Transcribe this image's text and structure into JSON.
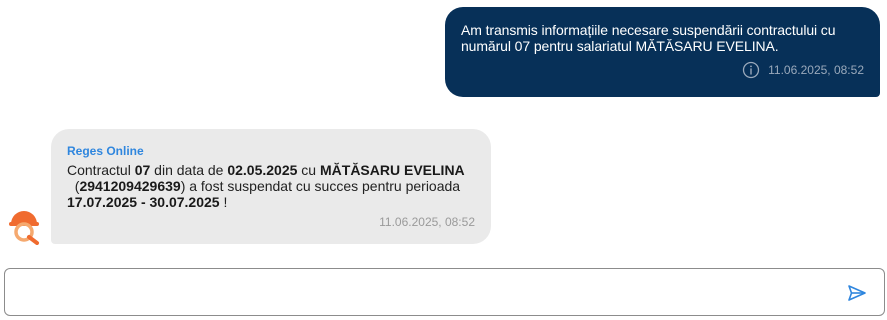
{
  "messages": {
    "outgoing": {
      "text": "Am transmis informațiile necesare suspendării contractului cu numărul 07 pentru salariatul MĂTĂSARU  EVELINA.",
      "timestamp": "11.06.2025, 08:52",
      "info_icon": "info-circle-icon"
    },
    "incoming": {
      "sender": "Reges Online",
      "parts": {
        "p1": "Contractul ",
        "contract_no": "07",
        "p2": " din data de ",
        "date": "02.05.2025",
        "p3": " cu ",
        "name": "MĂTĂSARU EVELINA",
        "p4": "  (",
        "cnp": "2941209429639",
        "p5": ") a fost suspendat cu succes pentru perioada ",
        "period": "17.07.2025 - 30.07.2025",
        "p6": " !"
      },
      "timestamp": "11.06.2025, 08:52",
      "avatar_icon": "reges-logo-icon"
    }
  },
  "composer": {
    "placeholder": "",
    "value": "",
    "send_icon": "send-icon"
  },
  "colors": {
    "outgoing_bg": "#073058",
    "incoming_bg": "#eaeaea",
    "sender": "#2f86de",
    "send_icon": "#2f86de",
    "avatar_primary": "#f06b2f",
    "avatar_secondary": "#f5a96f"
  }
}
